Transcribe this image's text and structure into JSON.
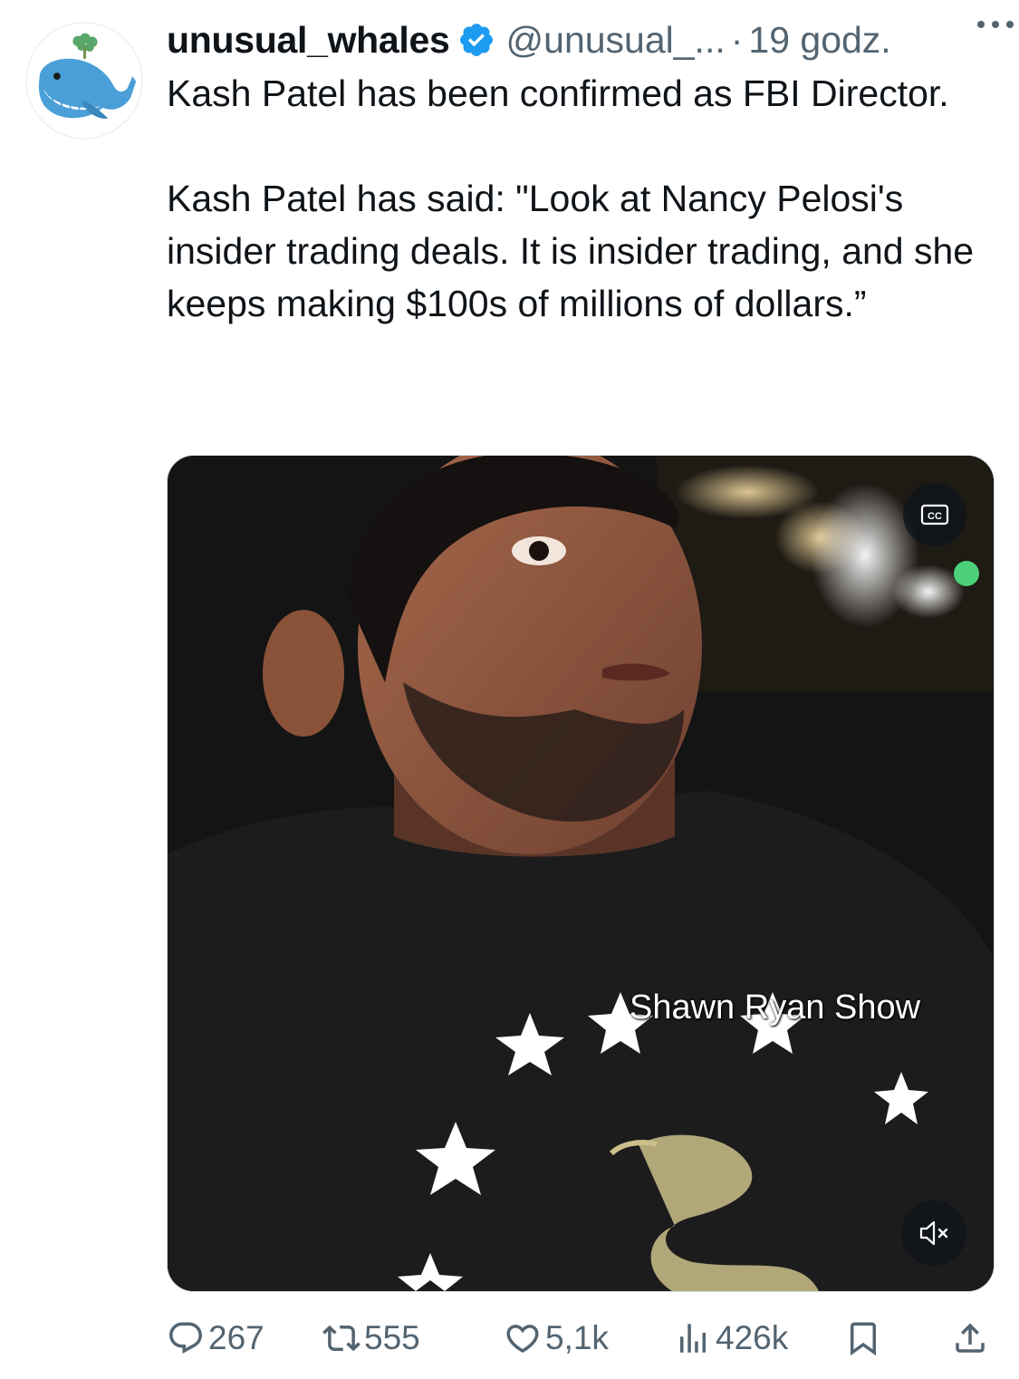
{
  "tweet": {
    "author": {
      "display_name": "unusual_whales",
      "handle": "@unusual_...",
      "verified": true,
      "avatar_icon": "whale-avatar-icon"
    },
    "separator": "·",
    "time": "19 godz.",
    "paragraphs": [
      "Kash Patel has been confirmed as FBI Director.",
      "Kash Patel has said: \"Look at Nancy Pelosi's insider trading deals. It is insider trading, and she keeps making $100s of millions of dollars.”"
    ],
    "media": {
      "overlay_caption": "Shawn Ryan Show",
      "captions_icon": "cc-icon",
      "mute_icon": "muted-speaker-icon"
    },
    "actions": {
      "replies": "267",
      "reposts": "555",
      "likes": "5,1k",
      "views": "426k"
    },
    "colors": {
      "text": "#0f1419",
      "secondary": "#536471",
      "verified_blue": "#1d9bf0"
    }
  }
}
